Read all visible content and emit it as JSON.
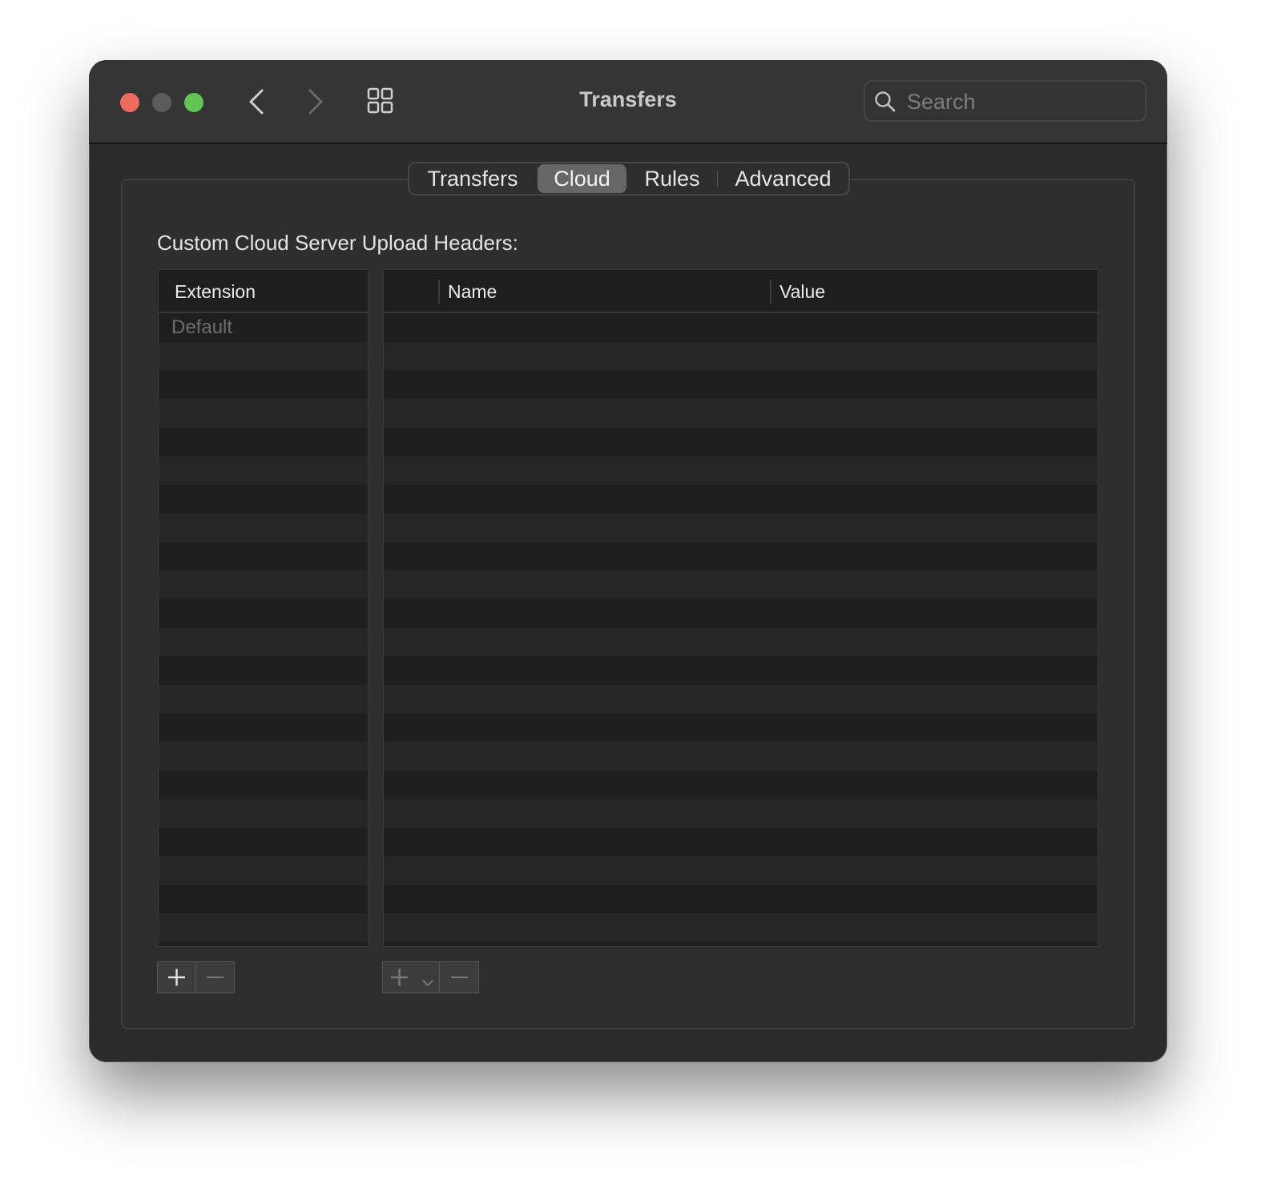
{
  "window": {
    "title": "Transfers"
  },
  "search": {
    "placeholder": "Search"
  },
  "tabs": [
    {
      "label": "Transfers",
      "active": false
    },
    {
      "label": "Cloud",
      "active": true
    },
    {
      "label": "Rules",
      "active": false
    },
    {
      "label": "Advanced",
      "active": false
    }
  ],
  "section": {
    "heading": "Custom Cloud Server Upload Headers:"
  },
  "extension_table": {
    "column": "Extension",
    "rows": [
      "Default"
    ]
  },
  "headers_table": {
    "columns": [
      "Name",
      "Value"
    ],
    "rows": []
  },
  "icons": {
    "close": "close-traffic-light",
    "minimize": "minimize-traffic-light",
    "zoom": "zoom-traffic-light",
    "back": "chevron-left-icon",
    "forward": "chevron-right-icon",
    "grid": "grid-icon",
    "search": "search-icon",
    "add": "plus-icon",
    "remove": "minus-icon",
    "add_menu": "chevron-down-icon"
  },
  "colors": {
    "close": "#ed6a5e",
    "zoom": "#61c554",
    "active_tab": "#666666",
    "window_bg": "#2b2b2b"
  }
}
